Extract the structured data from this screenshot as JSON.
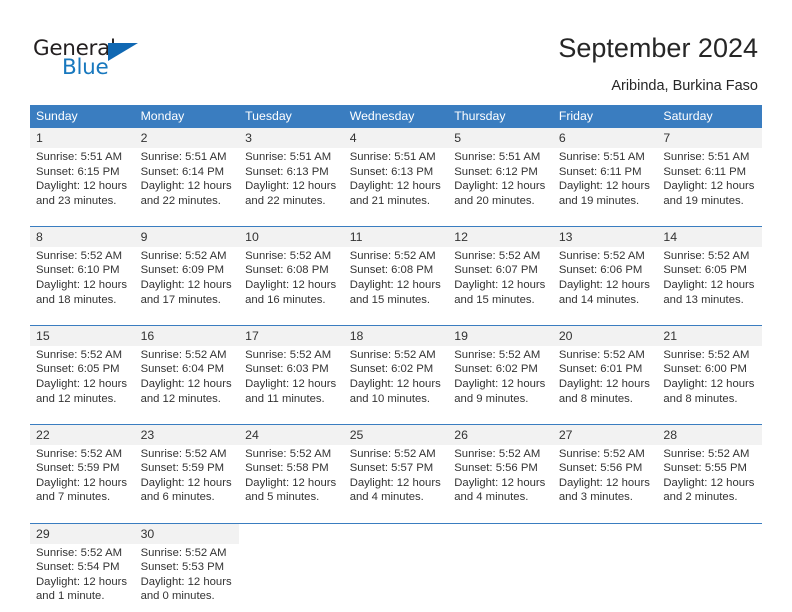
{
  "brand": {
    "name_dark": "General",
    "name_blue": "Blue",
    "logo_icon": "triangle-flag-icon",
    "accent_color": "#1068b3"
  },
  "header": {
    "title": "September 2024",
    "subtitle": "Aribinda, Burkina Faso"
  },
  "calendar": {
    "header_bg": "#3a7dc0",
    "daynum_bg": "#f2f2f2",
    "weekdays": [
      "Sunday",
      "Monday",
      "Tuesday",
      "Wednesday",
      "Thursday",
      "Friday",
      "Saturday"
    ],
    "weeks": [
      {
        "days": [
          {
            "num": "1",
            "l1": "Sunrise: 5:51 AM",
            "l2": "Sunset: 6:15 PM",
            "l3": "Daylight: 12 hours",
            "l4": "and 23 minutes."
          },
          {
            "num": "2",
            "l1": "Sunrise: 5:51 AM",
            "l2": "Sunset: 6:14 PM",
            "l3": "Daylight: 12 hours",
            "l4": "and 22 minutes."
          },
          {
            "num": "3",
            "l1": "Sunrise: 5:51 AM",
            "l2": "Sunset: 6:13 PM",
            "l3": "Daylight: 12 hours",
            "l4": "and 22 minutes."
          },
          {
            "num": "4",
            "l1": "Sunrise: 5:51 AM",
            "l2": "Sunset: 6:13 PM",
            "l3": "Daylight: 12 hours",
            "l4": "and 21 minutes."
          },
          {
            "num": "5",
            "l1": "Sunrise: 5:51 AM",
            "l2": "Sunset: 6:12 PM",
            "l3": "Daylight: 12 hours",
            "l4": "and 20 minutes."
          },
          {
            "num": "6",
            "l1": "Sunrise: 5:51 AM",
            "l2": "Sunset: 6:11 PM",
            "l3": "Daylight: 12 hours",
            "l4": "and 19 minutes."
          },
          {
            "num": "7",
            "l1": "Sunrise: 5:51 AM",
            "l2": "Sunset: 6:11 PM",
            "l3": "Daylight: 12 hours",
            "l4": "and 19 minutes."
          }
        ]
      },
      {
        "days": [
          {
            "num": "8",
            "l1": "Sunrise: 5:52 AM",
            "l2": "Sunset: 6:10 PM",
            "l3": "Daylight: 12 hours",
            "l4": "and 18 minutes."
          },
          {
            "num": "9",
            "l1": "Sunrise: 5:52 AM",
            "l2": "Sunset: 6:09 PM",
            "l3": "Daylight: 12 hours",
            "l4": "and 17 minutes."
          },
          {
            "num": "10",
            "l1": "Sunrise: 5:52 AM",
            "l2": "Sunset: 6:08 PM",
            "l3": "Daylight: 12 hours",
            "l4": "and 16 minutes."
          },
          {
            "num": "11",
            "l1": "Sunrise: 5:52 AM",
            "l2": "Sunset: 6:08 PM",
            "l3": "Daylight: 12 hours",
            "l4": "and 15 minutes."
          },
          {
            "num": "12",
            "l1": "Sunrise: 5:52 AM",
            "l2": "Sunset: 6:07 PM",
            "l3": "Daylight: 12 hours",
            "l4": "and 15 minutes."
          },
          {
            "num": "13",
            "l1": "Sunrise: 5:52 AM",
            "l2": "Sunset: 6:06 PM",
            "l3": "Daylight: 12 hours",
            "l4": "and 14 minutes."
          },
          {
            "num": "14",
            "l1": "Sunrise: 5:52 AM",
            "l2": "Sunset: 6:05 PM",
            "l3": "Daylight: 12 hours",
            "l4": "and 13 minutes."
          }
        ]
      },
      {
        "days": [
          {
            "num": "15",
            "l1": "Sunrise: 5:52 AM",
            "l2": "Sunset: 6:05 PM",
            "l3": "Daylight: 12 hours",
            "l4": "and 12 minutes."
          },
          {
            "num": "16",
            "l1": "Sunrise: 5:52 AM",
            "l2": "Sunset: 6:04 PM",
            "l3": "Daylight: 12 hours",
            "l4": "and 12 minutes."
          },
          {
            "num": "17",
            "l1": "Sunrise: 5:52 AM",
            "l2": "Sunset: 6:03 PM",
            "l3": "Daylight: 12 hours",
            "l4": "and 11 minutes."
          },
          {
            "num": "18",
            "l1": "Sunrise: 5:52 AM",
            "l2": "Sunset: 6:02 PM",
            "l3": "Daylight: 12 hours",
            "l4": "and 10 minutes."
          },
          {
            "num": "19",
            "l1": "Sunrise: 5:52 AM",
            "l2": "Sunset: 6:02 PM",
            "l3": "Daylight: 12 hours",
            "l4": "and 9 minutes."
          },
          {
            "num": "20",
            "l1": "Sunrise: 5:52 AM",
            "l2": "Sunset: 6:01 PM",
            "l3": "Daylight: 12 hours",
            "l4": "and 8 minutes."
          },
          {
            "num": "21",
            "l1": "Sunrise: 5:52 AM",
            "l2": "Sunset: 6:00 PM",
            "l3": "Daylight: 12 hours",
            "l4": "and 8 minutes."
          }
        ]
      },
      {
        "days": [
          {
            "num": "22",
            "l1": "Sunrise: 5:52 AM",
            "l2": "Sunset: 5:59 PM",
            "l3": "Daylight: 12 hours",
            "l4": "and 7 minutes."
          },
          {
            "num": "23",
            "l1": "Sunrise: 5:52 AM",
            "l2": "Sunset: 5:59 PM",
            "l3": "Daylight: 12 hours",
            "l4": "and 6 minutes."
          },
          {
            "num": "24",
            "l1": "Sunrise: 5:52 AM",
            "l2": "Sunset: 5:58 PM",
            "l3": "Daylight: 12 hours",
            "l4": "and 5 minutes."
          },
          {
            "num": "25",
            "l1": "Sunrise: 5:52 AM",
            "l2": "Sunset: 5:57 PM",
            "l3": "Daylight: 12 hours",
            "l4": "and 4 minutes."
          },
          {
            "num": "26",
            "l1": "Sunrise: 5:52 AM",
            "l2": "Sunset: 5:56 PM",
            "l3": "Daylight: 12 hours",
            "l4": "and 4 minutes."
          },
          {
            "num": "27",
            "l1": "Sunrise: 5:52 AM",
            "l2": "Sunset: 5:56 PM",
            "l3": "Daylight: 12 hours",
            "l4": "and 3 minutes."
          },
          {
            "num": "28",
            "l1": "Sunrise: 5:52 AM",
            "l2": "Sunset: 5:55 PM",
            "l3": "Daylight: 12 hours",
            "l4": "and 2 minutes."
          }
        ]
      },
      {
        "days": [
          {
            "num": "29",
            "l1": "Sunrise: 5:52 AM",
            "l2": "Sunset: 5:54 PM",
            "l3": "Daylight: 12 hours",
            "l4": "and 1 minute."
          },
          {
            "num": "30",
            "l1": "Sunrise: 5:52 AM",
            "l2": "Sunset: 5:53 PM",
            "l3": "Daylight: 12 hours",
            "l4": "and 0 minutes."
          },
          {
            "num": "",
            "l1": "",
            "l2": "",
            "l3": "",
            "l4": ""
          },
          {
            "num": "",
            "l1": "",
            "l2": "",
            "l3": "",
            "l4": ""
          },
          {
            "num": "",
            "l1": "",
            "l2": "",
            "l3": "",
            "l4": ""
          },
          {
            "num": "",
            "l1": "",
            "l2": "",
            "l3": "",
            "l4": ""
          },
          {
            "num": "",
            "l1": "",
            "l2": "",
            "l3": "",
            "l4": ""
          }
        ]
      }
    ]
  }
}
